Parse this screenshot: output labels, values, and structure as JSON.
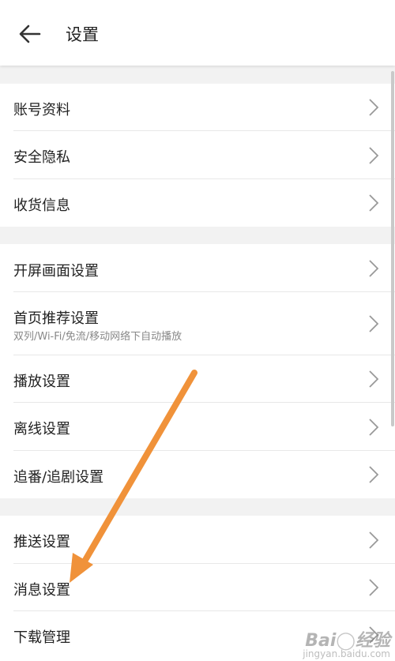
{
  "header": {
    "title": "设置"
  },
  "groups": [
    {
      "items": [
        {
          "label": "账号资料"
        },
        {
          "label": "安全隐私"
        },
        {
          "label": "收货信息"
        }
      ]
    },
    {
      "items": [
        {
          "label": "开屏画面设置"
        },
        {
          "label": "首页推荐设置",
          "subtitle": "双列/Wi-Fi/免流/移动网络下自动播放"
        },
        {
          "label": "播放设置"
        },
        {
          "label": "离线设置"
        },
        {
          "label": "追番/追剧设置"
        }
      ]
    },
    {
      "items": [
        {
          "label": "推送设置"
        },
        {
          "label": "消息设置"
        },
        {
          "label": "下载管理"
        }
      ]
    }
  ],
  "annotation": {
    "color": "#F0923A"
  },
  "watermark": {
    "text": "Bai&#8203;du经验",
    "sub": "jingyan.baidu.com"
  }
}
